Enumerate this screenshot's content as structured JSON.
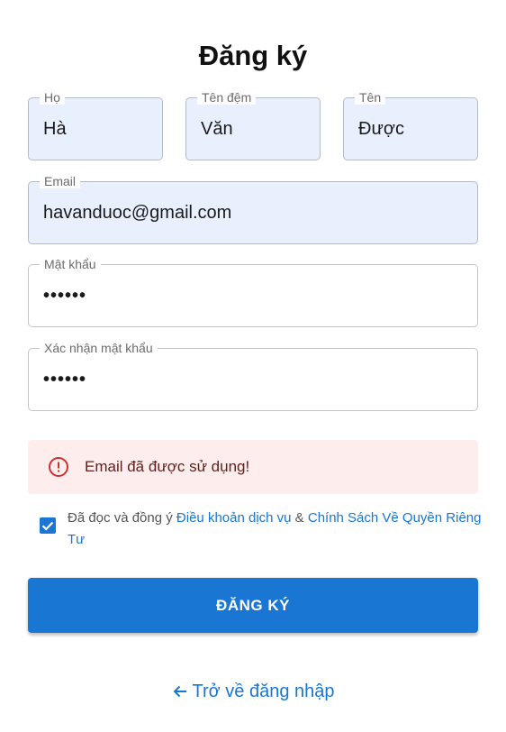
{
  "page": {
    "title": "Đăng ký"
  },
  "fields": {
    "last_name": {
      "label": "Họ",
      "value": "Hà"
    },
    "middle_name": {
      "label": "Tên đệm",
      "value": "Văn"
    },
    "first_name": {
      "label": "Tên",
      "value": "Được"
    },
    "email": {
      "label": "Email",
      "value": "havanduoc@gmail.com"
    },
    "password": {
      "label": "Mật khẩu",
      "value": "••••••"
    },
    "confirm_password": {
      "label": "Xác nhận mật khẩu",
      "value": "••••••"
    }
  },
  "alert": {
    "message": "Email đã được sử dụng!",
    "icon": "error-outline-icon",
    "color": "#d32f2f"
  },
  "consent": {
    "checked": true,
    "prefix": "Đã đọc và đồng ý ",
    "terms_link": "Điều khoản dịch vụ",
    "joiner": " & ",
    "privacy_link": "Chính Sách Về Quyền Riêng Tư"
  },
  "submit": {
    "label": "ĐĂNG KÝ"
  },
  "back_link": {
    "label": "Trở về đăng nhập",
    "icon": "arrow-left-icon"
  },
  "colors": {
    "primary": "#1976d2",
    "autofill_bg": "#e8f0fe",
    "alert_bg": "#fdeded",
    "alert_text": "#5f2120"
  }
}
